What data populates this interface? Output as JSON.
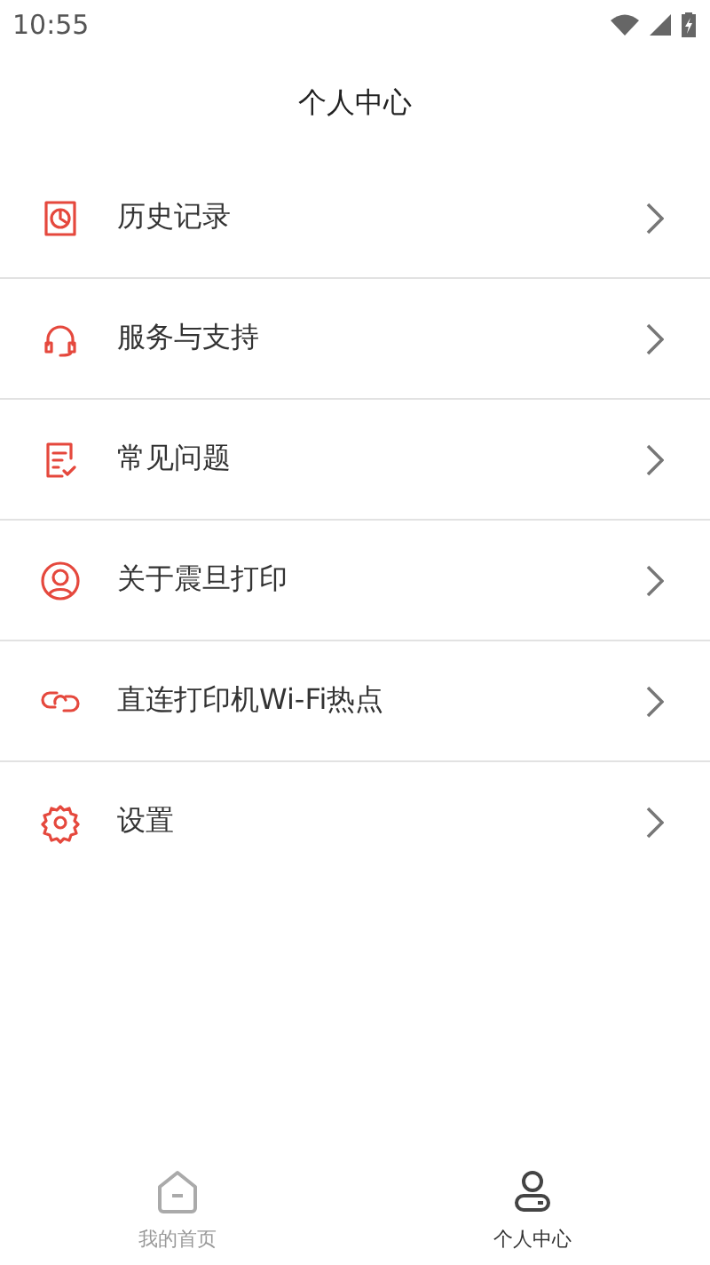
{
  "status_bar": {
    "time": "10:55"
  },
  "header": {
    "title": "个人中心"
  },
  "menu": [
    {
      "label": "历史记录"
    },
    {
      "label": "服务与支持"
    },
    {
      "label": "常见问题"
    },
    {
      "label": "关于震旦打印"
    },
    {
      "label": "直连打印机Wi-Fi热点"
    },
    {
      "label": "设置"
    }
  ],
  "bottom_nav": [
    {
      "label": "我的首页",
      "selected": false
    },
    {
      "label": "个人中心",
      "selected": true
    }
  ]
}
